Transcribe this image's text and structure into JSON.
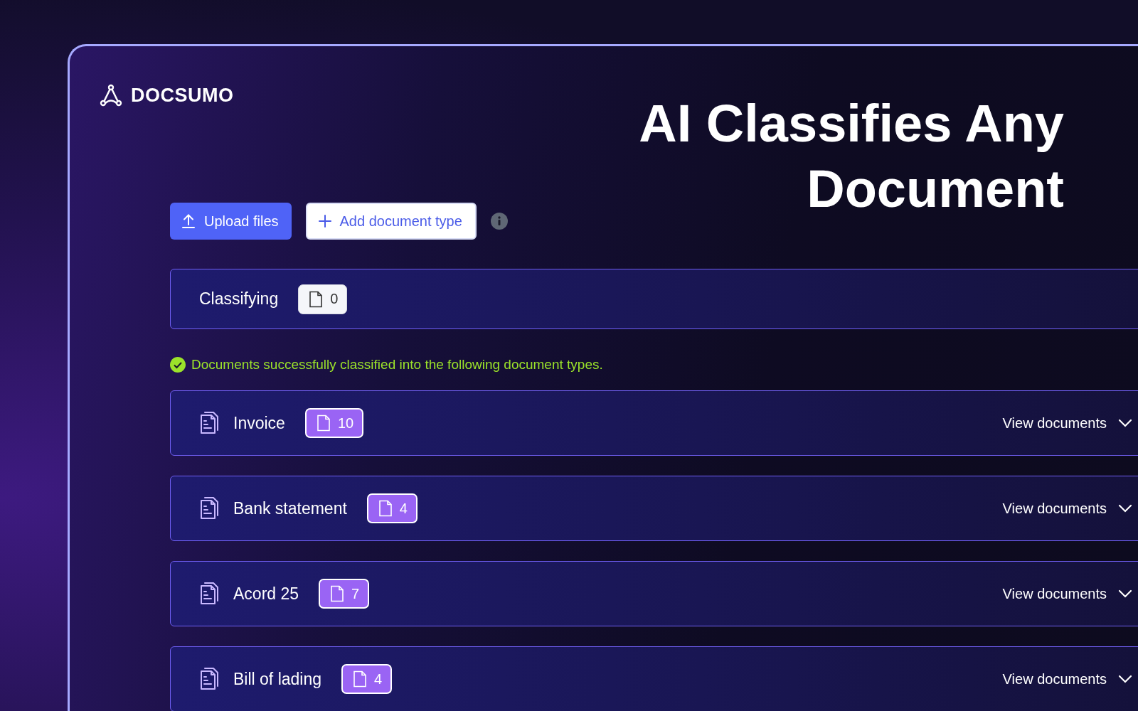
{
  "brand": {
    "name": "DOCSUMO"
  },
  "headline": [
    "AI Classifies Any",
    "Document"
  ],
  "actions": [
    {
      "kind": "primary",
      "label": "Upload files"
    },
    {
      "kind": "secondary",
      "label": "Add document type"
    }
  ],
  "classifying": {
    "label": "Classifying",
    "count": "0"
  },
  "message": {
    "success": true,
    "text": "Documents successfully classified into the following document types."
  },
  "document_types": [
    {
      "name": "Invoice",
      "count": "10",
      "action": "View documents",
      "expanded": false
    },
    {
      "name": "Bank statement",
      "count": "4",
      "action": "View documents",
      "expanded": false
    },
    {
      "name": "Acord 25",
      "count": "7",
      "action": "View documents",
      "expanded": false
    },
    {
      "name": "Bill of lading",
      "count": "4",
      "action": "View documents",
      "expanded": false
    }
  ]
}
